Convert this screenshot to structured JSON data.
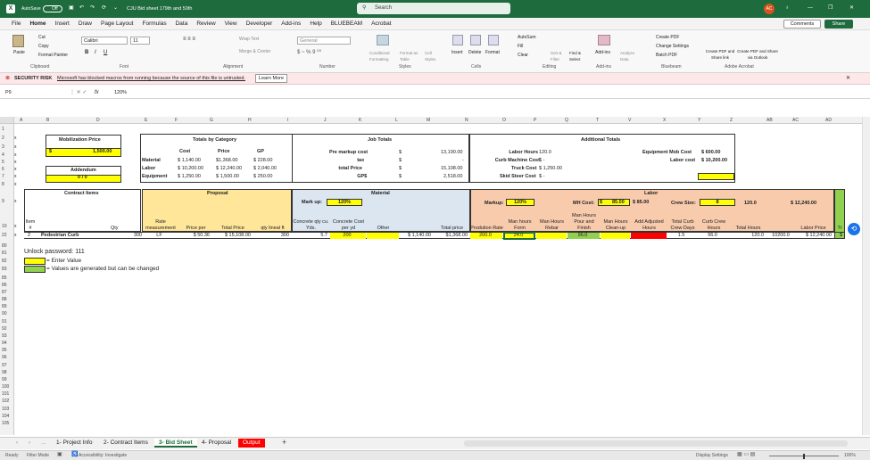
{
  "title": {
    "autosave": "AutoSave",
    "off": "Off",
    "filename": "CJU Bid sheet 179th and 50th",
    "search": "Search",
    "avatar": "AC"
  },
  "menu": [
    "File",
    "Home",
    "Insert",
    "Draw",
    "Page Layout",
    "Formulas",
    "Data",
    "Review",
    "View",
    "Developer",
    "Add-ins",
    "Help",
    "BLUEBEAM",
    "Acrobat"
  ],
  "menu_right": {
    "comments": "Comments",
    "share": "Share"
  },
  "ribbon": {
    "paste": "Paste",
    "cut": "Cut",
    "copy": "Copy",
    "format_painter": "Format Painter",
    "clipboard": "Clipboard",
    "font_name": "Calibri",
    "font_size": "11",
    "font": "Font",
    "wrap_text": "Wrap Text",
    "merge_center": "Merge & Center",
    "alignment": "Alignment",
    "number_fmt": "General",
    "number": "Number",
    "cond_fmt": "Conditional Formatting",
    "format_as_table": "Format as Table",
    "cell_styles": "Cell Styles",
    "styles": "Styles",
    "insert": "Insert",
    "delete": "Delete",
    "format": "Format",
    "cells": "Cells",
    "autosum": "AutoSum",
    "fill": "Fill",
    "clear": "Clear",
    "sort_filter": "Sort & Filter",
    "find_select": "Find & Select",
    "editing": "Editing",
    "addins": "Add-ins",
    "analyze": "Analyze Data",
    "addins_grp": "Add-ins",
    "create_pdf": "Create PDF",
    "change_settings": "Change Settings",
    "batch_pdf": "Batch PDF",
    "bluebeam": "Bluebeam",
    "create_pdf_share": "Create PDF and Share link",
    "create_pdf_outlook": "Create PDF and Share via Outlook",
    "adobe": "Adobe Acrobat"
  },
  "security": {
    "label": "SECURITY RISK",
    "message": "Microsoft has blocked macros from running because the source of this file is untrusted.",
    "button": "Learn More"
  },
  "formula": {
    "namebox": "P9",
    "fx": "fx",
    "value": "120%"
  },
  "columns": [
    "A",
    "B",
    "D",
    "E",
    "F",
    "G",
    "H",
    "I",
    "J",
    "K",
    "L",
    "M",
    "N",
    "O",
    "P",
    "Q",
    "T",
    "V",
    "X",
    "Y",
    "Z",
    "AB",
    "AC",
    "AD"
  ],
  "rows": [
    "1",
    "2",
    "3",
    "4",
    "5",
    "6",
    "7",
    "8",
    "9",
    "10",
    "11",
    "22",
    "80",
    "81",
    "82",
    "83",
    "85",
    "86",
    "87",
    "88",
    "89",
    "90",
    "91",
    "92",
    "93",
    "94",
    "95",
    "96",
    "97",
    "98",
    "99",
    "100",
    "101",
    "102",
    "103",
    "104",
    "105"
  ],
  "sheet": {
    "mob_title": "Mobilization Price",
    "mob_dollar": "$",
    "mob_val": "1,500.00",
    "add_title": "Addendum",
    "add_val": "0 / 0",
    "totals_title": "Totals by Category",
    "tc_cost": "Cost",
    "tc_price": "Price",
    "tc_gp": "GP",
    "tc_rows": [
      {
        "label": "Material",
        "cost": "$   1,140.00",
        "price": "$1,368.00",
        "gp": "$     228.00"
      },
      {
        "label": "Labor",
        "cost": "$ 10,200.00",
        "price": "$ 12,240.00",
        "gp": "$  2,040.00"
      },
      {
        "label": "Equipment",
        "cost": "$   1,250.00",
        "price": "$   1,500.00",
        "gp": "$     250.00"
      }
    ],
    "jt_title": "Job Totals",
    "jt_rows": [
      {
        "label": "Pre markup cost",
        "d": "$",
        "val": "13,190.00"
      },
      {
        "label": "tax",
        "d": "$",
        "val": "-"
      },
      {
        "label": "total Price",
        "d": "$",
        "val": "15,108.00"
      },
      {
        "label": "GP$",
        "d": "$",
        "val": "2,518.00"
      }
    ],
    "at_title": "Additional Totals",
    "at_rows": [
      {
        "label": "Labor Hours",
        "val": "120.0"
      },
      {
        "label": "Curb Machine Cost",
        "val": "$          -"
      },
      {
        "label": "Truck Cost",
        "val": "$  1,250.00"
      },
      {
        "label": "Skid Steer Cost",
        "val": "$          -"
      }
    ],
    "eq_mob_label": "Equipment Mob Cost",
    "eq_mob_val": "$      600.00",
    "labor_cost_label": "Labor cost",
    "labor_cost_val": "$ 10,200.00",
    "ci_title": "Contract Items",
    "prop_title": "Proposal",
    "mat_title": "Material",
    "lab_title": "Labor",
    "markup_label": "Mark up:",
    "markup_val": "120%",
    "markup2_label": "Markup:",
    "markup2_val": "120%",
    "mh_label": "MH Cost:",
    "mh_d": "$",
    "mh_val": "85.00",
    "mh_val2": "$       85.00",
    "crew_label": "Crew Size:",
    "crew_val": "8",
    "hrs_top": "120.0",
    "price_top": "$        12,240.00",
    "hdr": [
      "Item #",
      "",
      "Qty",
      "Rate measurement",
      "Price per",
      "Total Price",
      "qty lineal ft",
      "Concrete qty cu. Yds.",
      "Concrete Cost per yd",
      "Other",
      "",
      "Total price",
      "Prodution Rate",
      "Man hours Form",
      "Man Hours Rebar",
      "Man Hours Pour and Finish",
      "Man Hours Clean-up",
      "Add Adjusted Hours",
      "Total Curb Crew Days",
      "Curb Crew Hours",
      "Total Hours",
      "",
      "Labor Price",
      "Tr"
    ],
    "row22": [
      "2",
      "Pedestrian Curb",
      "300",
      "LF",
      "$     50.36",
      "$  15,108.00",
      "300",
      "5.7",
      "200",
      "",
      "$  1,140.00",
      "$1,368.00",
      "200.0",
      "24.0",
      "",
      "96.0",
      "",
      "",
      "1.5",
      "96.0",
      "120.0",
      "10200.0",
      "$    12,240.00",
      "$"
    ],
    "unlock": "Unlock password: 111",
    "legend1": "= Enter Value",
    "legend2": "= Values are generated but can be changed"
  },
  "tabs": [
    "1- Project Info",
    "2- Contract Items",
    "3- Bid Sheet",
    "4- Proposal",
    "Output"
  ],
  "status": {
    "ready": "Ready",
    "filter": "Filter Mode",
    "access": "Accessibility: Investigate",
    "display": "Display Settings",
    "zoom": "100%"
  }
}
